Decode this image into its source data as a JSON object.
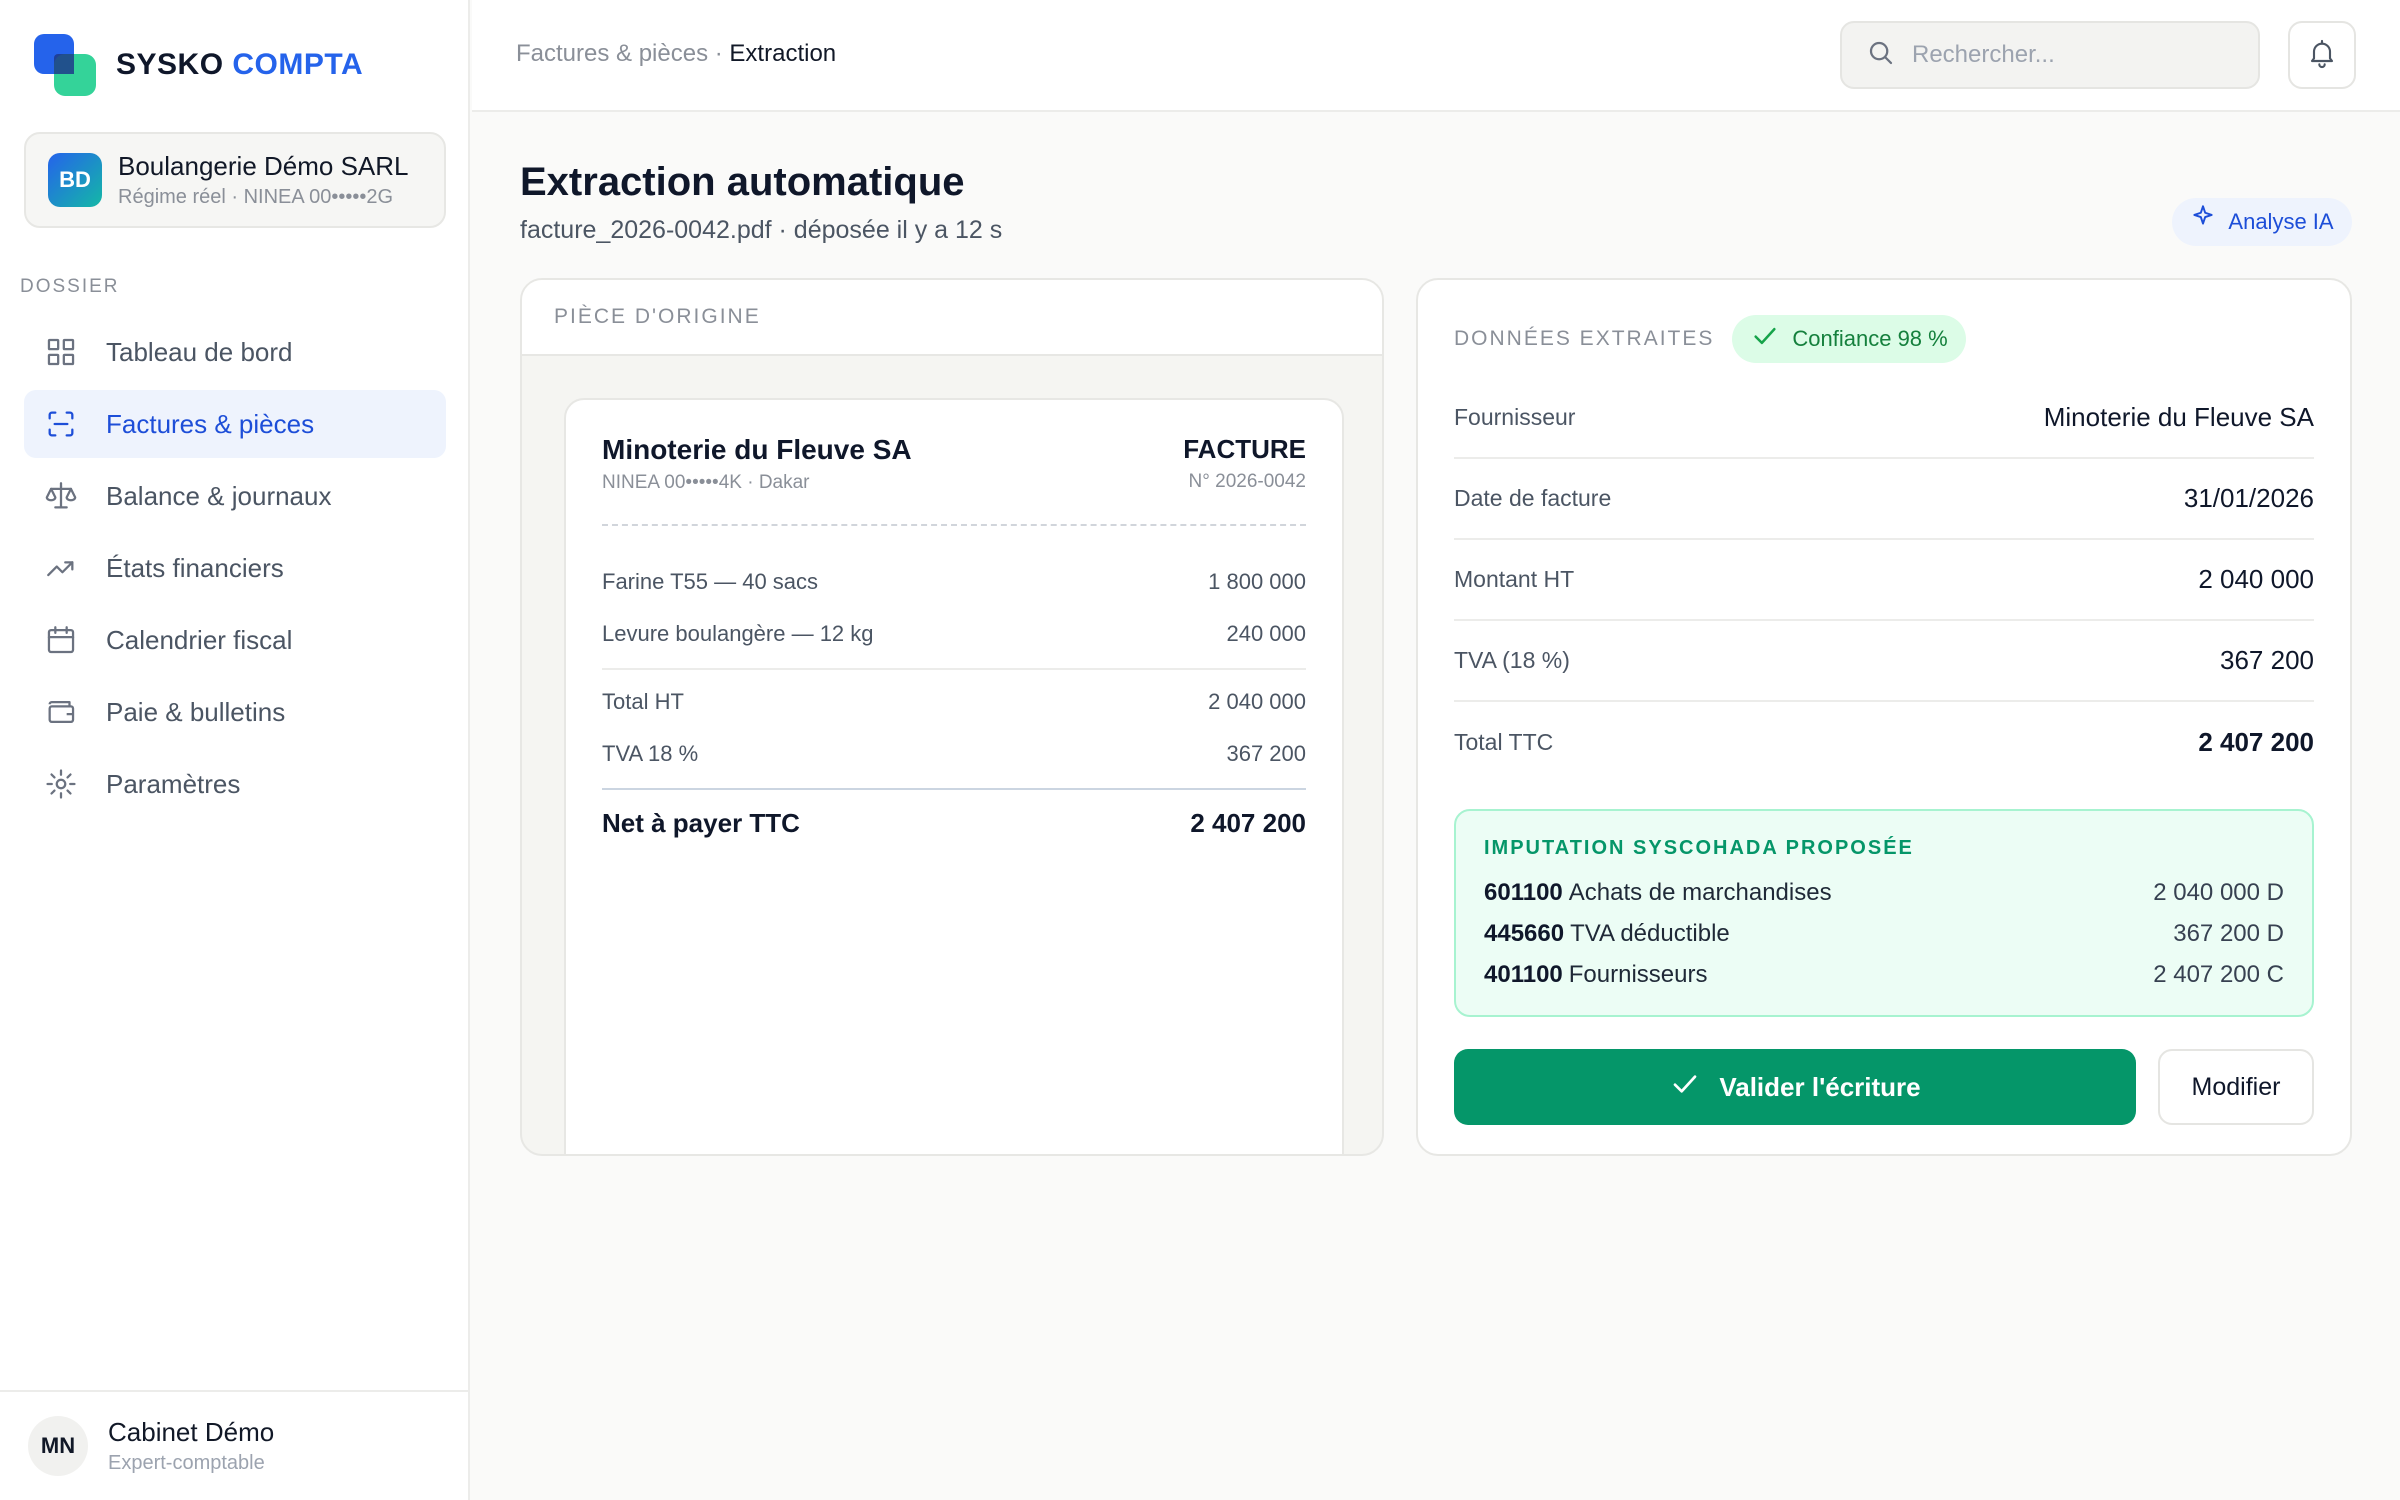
{
  "brand": {
    "name_main": "SYSKO",
    "name_accent": "COMPTA",
    "colors": {
      "primary": "#2563eb",
      "secondary": "#34d399"
    }
  },
  "company": {
    "initials": "BD",
    "name": "Boulangerie Démo SARL",
    "subtitle": "Régime réel · NINEA 00•••••2G"
  },
  "sidebar": {
    "section_label": "DOSSIER",
    "items": [
      {
        "label": "Tableau de bord",
        "icon": "grid-icon",
        "active": false
      },
      {
        "label": "Factures & pièces",
        "icon": "scan-icon",
        "active": true
      },
      {
        "label": "Balance & journaux",
        "icon": "scale-icon",
        "active": false
      },
      {
        "label": "États financiers",
        "icon": "trending-up-icon",
        "active": false
      },
      {
        "label": "Calendrier fiscal",
        "icon": "calendar-icon",
        "active": false
      },
      {
        "label": "Paie & bulletins",
        "icon": "wallet-icon",
        "active": false
      },
      {
        "label": "Paramètres",
        "icon": "gear-icon",
        "active": false
      }
    ]
  },
  "user": {
    "initials": "MN",
    "name": "Cabinet Démo",
    "role": "Expert-comptable"
  },
  "topbar": {
    "breadcrumb_parent": "Factures & pièces",
    "breadcrumb_separator": " · ",
    "breadcrumb_current": "Extraction",
    "search_placeholder": "Rechercher...",
    "search_icon": "search-icon",
    "bell_icon": "bell-icon"
  },
  "page": {
    "title": "Extraction automatique",
    "subtitle": "facture_2026-0042.pdf · déposée il y a 12 s",
    "ai_badge": "Analyse IA"
  },
  "original": {
    "header": "PIÈCE D'ORIGINE",
    "supplier": "Minoterie du Fleuve SA",
    "supplier_sub": "NINEA 00•••••4K · Dakar",
    "doc_type": "FACTURE",
    "doc_number": "N° 2026-0042",
    "lines": [
      {
        "label": "Farine T55 — 40 sacs",
        "amount": "1 800 000"
      },
      {
        "label": "Levure boulangère — 12 kg",
        "amount": "240 000"
      }
    ],
    "subtotals": [
      {
        "label": "Total HT",
        "amount": "2 040 000"
      },
      {
        "label": "TVA 18 %",
        "amount": "367 200"
      }
    ],
    "total": {
      "label": "Net à payer TTC",
      "amount": "2 407 200"
    }
  },
  "extracted": {
    "header": "DONNÉES EXTRAITES",
    "confidence": "Confiance 98 %",
    "confidence_color": "#15803d",
    "fields": [
      {
        "label": "Fournisseur",
        "value": "Minoterie du Fleuve SA",
        "bold": false
      },
      {
        "label": "Date de facture",
        "value": "31/01/2026",
        "bold": false
      },
      {
        "label": "Montant HT",
        "value": "2 040 000",
        "bold": false
      },
      {
        "label": "TVA (18 %)",
        "value": "367 200",
        "bold": false
      },
      {
        "label": "Total TTC",
        "value": "2 407 200",
        "bold": true
      }
    ],
    "imputation": {
      "title": "IMPUTATION SYSCOHADA PROPOSÉE",
      "rows": [
        {
          "account": "601100",
          "label": "Achats de marchandises",
          "amount": "2 040 000 D"
        },
        {
          "account": "445660",
          "label": "TVA déductible",
          "amount": "367 200 D"
        },
        {
          "account": "401100",
          "label": "Fournisseurs",
          "amount": "2 407 200 C"
        }
      ]
    },
    "validate_label": "Valider l'écriture",
    "modify_label": "Modifier",
    "validate_color": "#059669"
  }
}
